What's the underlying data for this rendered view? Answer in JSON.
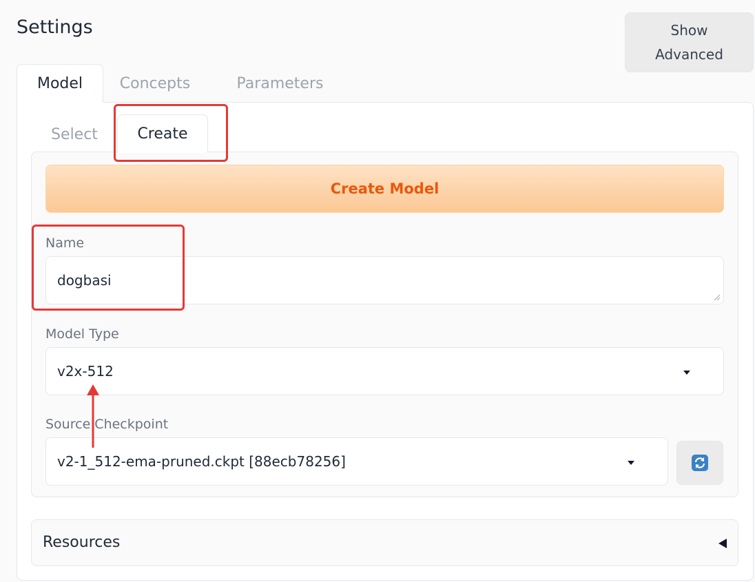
{
  "header": {
    "title": "Settings",
    "show_advanced_label": "Show\nAdvanced"
  },
  "outer_tabs": [
    {
      "label": "Model",
      "active": true
    },
    {
      "label": "Concepts",
      "active": false
    },
    {
      "label": "Parameters",
      "active": false
    }
  ],
  "inner_tabs": [
    {
      "label": "Select",
      "active": false
    },
    {
      "label": "Create",
      "active": true
    }
  ],
  "create_model_button": "Create Model",
  "fields": {
    "name": {
      "label": "Name",
      "value": "dogbasi"
    },
    "model_type": {
      "label": "Model Type",
      "value": "v2x-512"
    },
    "source_checkpoint": {
      "label": "Source Checkpoint",
      "value": "v2-1_512-ema-pruned.ckpt [88ecb78256]"
    }
  },
  "resources": {
    "label": "Resources"
  },
  "icons": {
    "refresh": "refresh-icon",
    "dropdown": "chevron-down-icon",
    "collapse": "caret-left-icon"
  },
  "colors": {
    "accent_orange": "#ea580c",
    "annotation_red": "#e53935"
  }
}
